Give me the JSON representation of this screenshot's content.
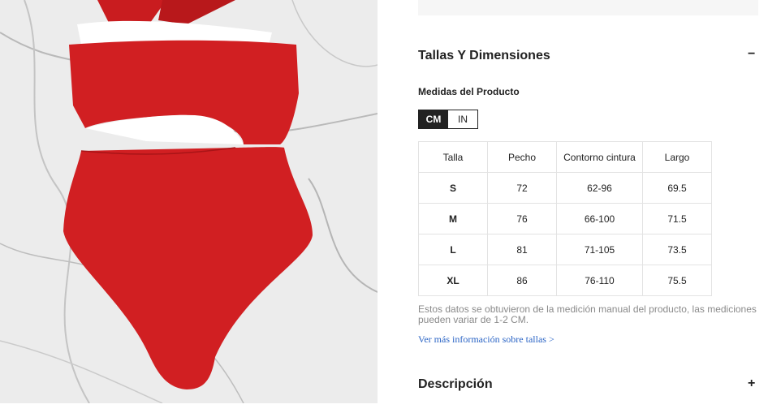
{
  "product_image": {
    "alt": "",
    "colors": {
      "swimsuit": "#d11f22",
      "lining": "#ffffff",
      "marble": "#ececec"
    }
  },
  "size_section": {
    "title": "Tallas Y Dimensiones",
    "toggle": "−",
    "subtitle": "Medidas del Producto",
    "units": [
      {
        "label": "CM",
        "active": true
      },
      {
        "label": "IN",
        "active": false
      }
    ],
    "table": {
      "headers": [
        "Talla",
        "Pecho",
        "Contorno cintura",
        "Largo"
      ],
      "rows": [
        [
          "S",
          "72",
          "62-96",
          "69.5"
        ],
        [
          "M",
          "76",
          "66-100",
          "71.5"
        ],
        [
          "L",
          "81",
          "71-105",
          "73.5"
        ],
        [
          "XL",
          "86",
          "76-110",
          "75.5"
        ]
      ]
    },
    "note": "Estos datos se obtuvieron de la medición manual del producto, las mediciones pueden variar de 1-2 CM.",
    "more_link": "Ver más información sobre tallas >"
  },
  "description_section": {
    "title": "Descripción",
    "toggle": "+"
  },
  "colors": {
    "link": "#2a64c5",
    "active_unit": "#222222",
    "border": "#e3e3e3"
  }
}
